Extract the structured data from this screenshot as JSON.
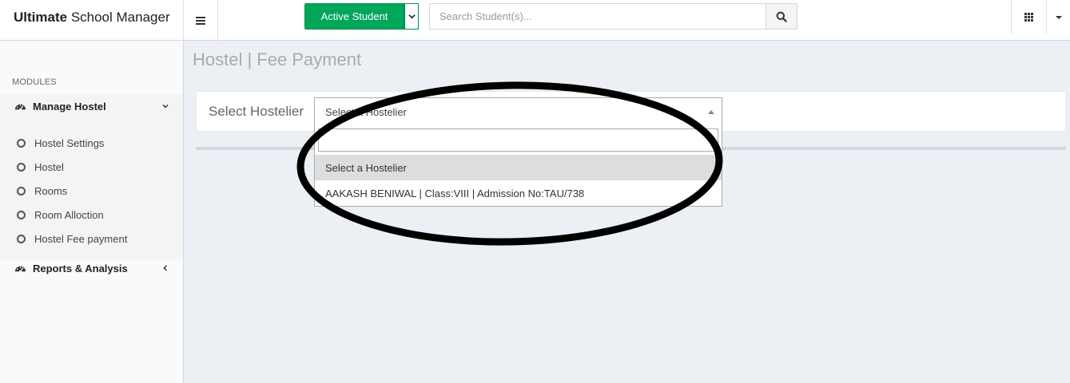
{
  "header": {
    "brand_bold": "Ultimate",
    "brand_rest": "School Manager",
    "active_student_label": "Active Student",
    "search_placeholder": "Search Student(s)..."
  },
  "sidebar": {
    "modules_header": "MODULES",
    "manage_hostel": "Manage Hostel",
    "items": [
      {
        "label": "Hostel Settings"
      },
      {
        "label": "Hostel"
      },
      {
        "label": "Rooms"
      },
      {
        "label": "Room Alloction"
      },
      {
        "label": "Hostel Fee payment"
      }
    ],
    "reports": "Reports & Analysis"
  },
  "main": {
    "page_title": "Hostel | Fee Payment",
    "select_label": "Select Hostelier",
    "select_value": "Select a Hostelier",
    "dropdown_options": [
      {
        "label": "Select a Hostelier",
        "highlighted": true
      },
      {
        "label": "AAKASH BENIWAL | Class:VIII | Admission No:TAU/738",
        "highlighted": false
      }
    ]
  },
  "colors": {
    "accent_green": "#00a65a",
    "page_bg": "#ecf0f5",
    "sidebar_bg": "#f9fafc"
  },
  "icons": [
    "hamburger-icon",
    "chevron-down-icon",
    "search-icon",
    "grid-icon",
    "caret-down-icon",
    "dashboard-icon",
    "chevron-left-icon",
    "circle-icon"
  ]
}
